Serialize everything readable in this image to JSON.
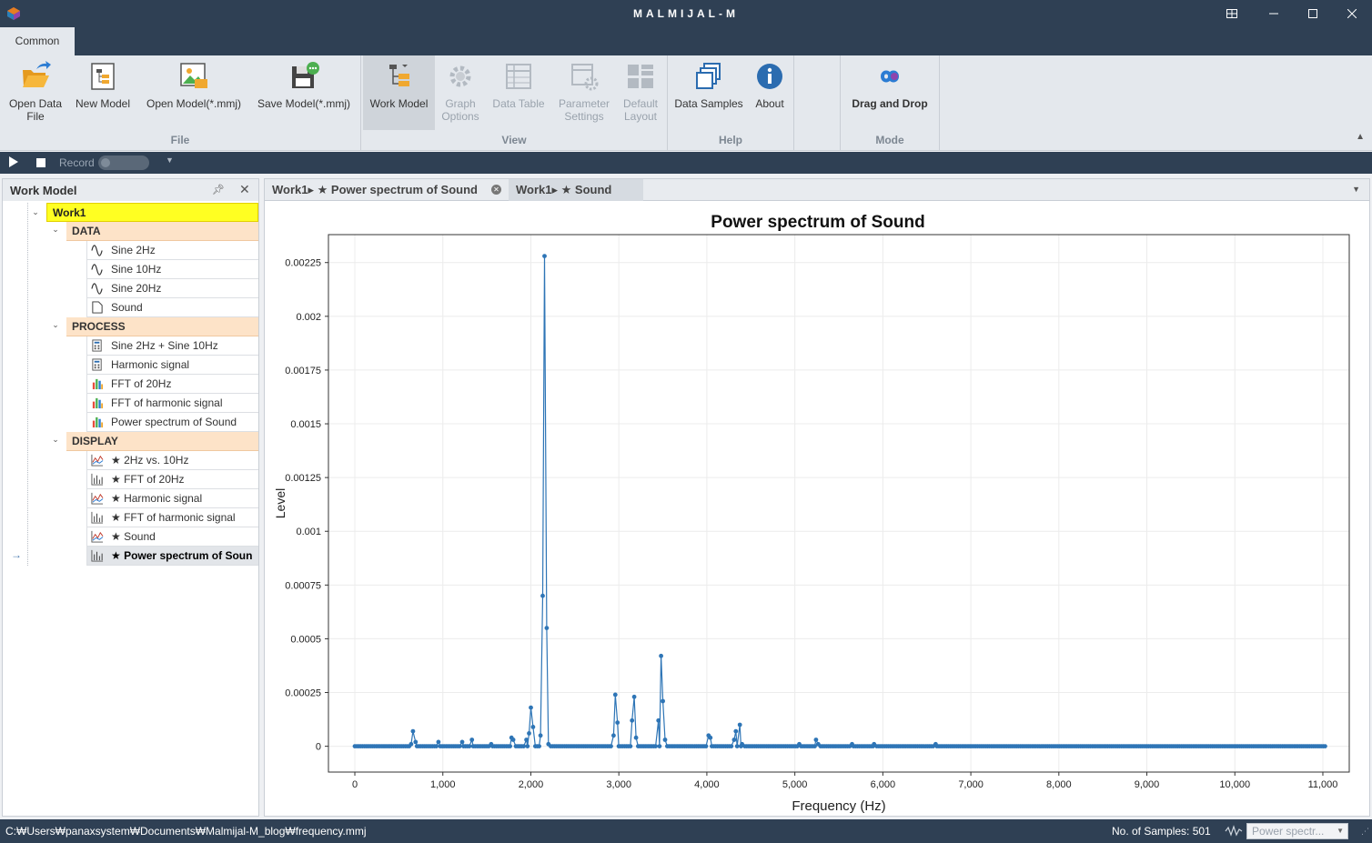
{
  "window": {
    "title": "MALMIJAL-M",
    "controls": [
      "restore-layout",
      "minimize",
      "maximize",
      "close"
    ]
  },
  "ribbon": {
    "tab": "Common",
    "groups": [
      {
        "label": "File",
        "buttons": [
          {
            "name": "open-data-file",
            "label1": "Open Data",
            "label2": "File",
            "icon": "folder-open-icon"
          },
          {
            "name": "new-model",
            "label1": "New Model",
            "label2": "",
            "icon": "new-model-icon"
          },
          {
            "name": "open-model",
            "label1": "Open Model(*.mmj)",
            "label2": "",
            "icon": "open-model-icon"
          },
          {
            "name": "save-model",
            "label1": "Save Model(*.mmj)",
            "label2": "",
            "icon": "save-model-icon"
          }
        ]
      },
      {
        "label": "View",
        "buttons": [
          {
            "name": "work-model",
            "label1": "Work Model",
            "label2": "",
            "icon": "work-model-icon",
            "active": true
          },
          {
            "name": "graph-options",
            "label1": "Graph",
            "label2": "Options",
            "icon": "gear-icon",
            "disabled": true
          },
          {
            "name": "data-table",
            "label1": "Data Table",
            "label2": "",
            "icon": "table-icon",
            "disabled": true
          },
          {
            "name": "parameter-settings",
            "label1": "Parameter",
            "label2": "Settings",
            "icon": "settings-window-icon",
            "disabled": true
          },
          {
            "name": "default-layout",
            "label1": "Default",
            "label2": "Layout",
            "icon": "layout-icon",
            "disabled": true
          }
        ]
      },
      {
        "label": "Help",
        "buttons": [
          {
            "name": "data-samples",
            "label1": "Data Samples",
            "label2": "",
            "icon": "stack-icon"
          },
          {
            "name": "about",
            "label1": "About",
            "label2": "",
            "icon": "info-icon"
          }
        ]
      },
      {
        "label": "Mode",
        "buttons": [
          {
            "name": "drag-and-drop",
            "label1": "Drag and Drop",
            "label2": "",
            "icon": "infinity-icon",
            "bold": true
          }
        ]
      }
    ]
  },
  "recordbar": {
    "record_label": "Record"
  },
  "work_model_panel": {
    "title": "Work Model",
    "root": "Work1",
    "categories": [
      {
        "label": "DATA",
        "items": [
          {
            "label": "Sine 2Hz",
            "icon": "sine-wave-icon"
          },
          {
            "label": "Sine 10Hz",
            "icon": "sine-wave-icon"
          },
          {
            "label": "Sine 20Hz",
            "icon": "sine-wave-icon"
          },
          {
            "label": "Sound",
            "icon": "file-icon"
          }
        ]
      },
      {
        "label": "PROCESS",
        "items": [
          {
            "label": "Sine 2Hz + Sine 10Hz",
            "icon": "calculator-icon"
          },
          {
            "label": "Harmonic signal",
            "icon": "calculator-icon"
          },
          {
            "label": "FFT of 20Hz",
            "icon": "bar-chart-icon"
          },
          {
            "label": "FFT of harmonic signal",
            "icon": "bar-chart-icon"
          },
          {
            "label": "Power spectrum of Sound",
            "icon": "bar-chart-icon"
          }
        ]
      },
      {
        "label": "DISPLAY",
        "items": [
          {
            "label": "★ 2Hz vs. 10Hz",
            "icon": "line-chart-icon"
          },
          {
            "label": "★ FFT of 20Hz",
            "icon": "stem-chart-icon"
          },
          {
            "label": "★ Harmonic signal",
            "icon": "line-chart-icon"
          },
          {
            "label": "★ FFT of harmonic signal",
            "icon": "stem-chart-icon"
          },
          {
            "label": "★ Sound",
            "icon": "line-chart-icon"
          },
          {
            "label": "★ Power spectrum of Soun",
            "icon": "stem-chart-icon",
            "selected": true
          }
        ]
      }
    ]
  },
  "document_tabs": [
    {
      "label": "Work1▸ ★ Power spectrum of Sound",
      "closable": true
    },
    {
      "label": "Work1▸ ★ Sound",
      "closable": false,
      "active": true
    }
  ],
  "chart_data": {
    "type": "line",
    "title": "Power spectrum of Sound",
    "xlabel": "Frequency (Hz)",
    "ylabel": "Level",
    "xlim": [
      -300,
      11300
    ],
    "ylim": [
      -0.00012,
      0.00238
    ],
    "x_ticks": [
      0,
      1000,
      2000,
      3000,
      4000,
      5000,
      6000,
      7000,
      8000,
      9000,
      10000,
      11000
    ],
    "x_tick_labels": [
      "0",
      "1,000",
      "2,000",
      "3,000",
      "4,000",
      "5,000",
      "6,000",
      "7,000",
      "8,000",
      "9,000",
      "10,000",
      "11,000"
    ],
    "y_ticks": [
      0,
      0.00025,
      0.0005,
      0.00075,
      0.001,
      0.00125,
      0.0015,
      0.00175,
      0.002,
      0.00225
    ],
    "y_tick_labels": [
      "0",
      "0.00025",
      "0.0005",
      "0.00075",
      "0.001",
      "0.00125",
      "0.0015",
      "0.00175",
      "0.002",
      "0.00225"
    ],
    "grid": true,
    "color": "#2e75b6",
    "n_samples": 501,
    "x_max": 11025,
    "peaks": [
      {
        "x": 640,
        "y": 1e-05
      },
      {
        "x": 660,
        "y": 7e-05
      },
      {
        "x": 690,
        "y": 2e-05
      },
      {
        "x": 950,
        "y": 2e-05
      },
      {
        "x": 1220,
        "y": 2e-05
      },
      {
        "x": 1330,
        "y": 3e-05
      },
      {
        "x": 1550,
        "y": 1e-05
      },
      {
        "x": 1780,
        "y": 4e-05
      },
      {
        "x": 1800,
        "y": 3e-05
      },
      {
        "x": 1950,
        "y": 3e-05
      },
      {
        "x": 1980,
        "y": 6e-05
      },
      {
        "x": 2000,
        "y": 0.00018
      },
      {
        "x": 2025,
        "y": 9e-05
      },
      {
        "x": 2110,
        "y": 5e-05
      },
      {
        "x": 2135,
        "y": 0.0007
      },
      {
        "x": 2155,
        "y": 0.00228
      },
      {
        "x": 2180,
        "y": 0.00055
      },
      {
        "x": 2200,
        "y": 1e-05
      },
      {
        "x": 2940,
        "y": 5e-05
      },
      {
        "x": 2960,
        "y": 0.00024
      },
      {
        "x": 2985,
        "y": 0.00011
      },
      {
        "x": 3150,
        "y": 0.00012
      },
      {
        "x": 3175,
        "y": 0.00023
      },
      {
        "x": 3195,
        "y": 4e-05
      },
      {
        "x": 3450,
        "y": 0.00012
      },
      {
        "x": 3480,
        "y": 0.00042
      },
      {
        "x": 3500,
        "y": 0.00021
      },
      {
        "x": 3525,
        "y": 3e-05
      },
      {
        "x": 4020,
        "y": 5e-05
      },
      {
        "x": 4040,
        "y": 4e-05
      },
      {
        "x": 4310,
        "y": 3e-05
      },
      {
        "x": 4330,
        "y": 7e-05
      },
      {
        "x": 4355,
        "y": 0.0001
      },
      {
        "x": 4375,
        "y": 0.0001
      },
      {
        "x": 4400,
        "y": 1e-05
      },
      {
        "x": 5050,
        "y": 1e-05
      },
      {
        "x": 5240,
        "y": 3e-05
      },
      {
        "x": 5265,
        "y": 1e-05
      },
      {
        "x": 5650,
        "y": 1e-05
      },
      {
        "x": 5900,
        "y": 1e-05
      },
      {
        "x": 6600,
        "y": 1e-05
      }
    ]
  },
  "statusbar": {
    "path": "C:₩Users₩panaxsystem₩Documents₩Malmijal-M_blog₩frequency.mmj",
    "samples": "No. of Samples: 501",
    "combo_value": "Power spectr..."
  }
}
